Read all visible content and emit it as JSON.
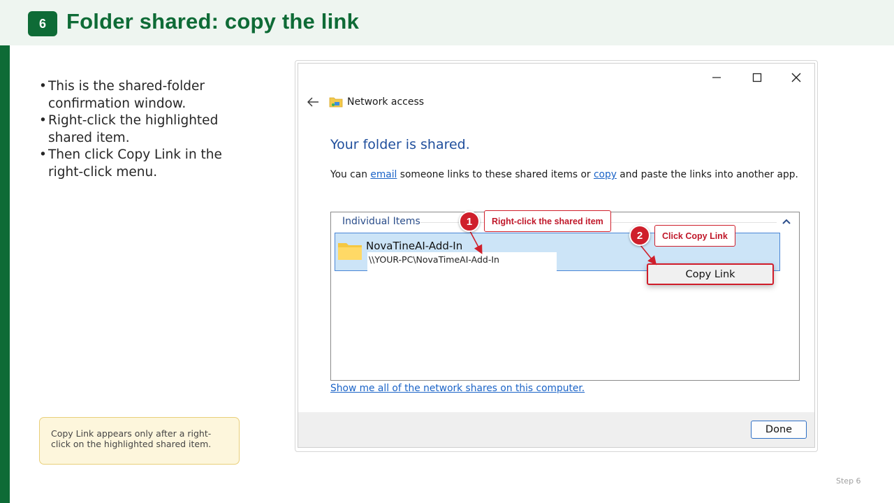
{
  "slide": {
    "step_number": "6",
    "title": "Folder shared: copy the link",
    "bullets": [
      "This is the shared-folder confirmation window.",
      "Right-click the highlighted shared item.",
      "Then click Copy Link in the right-click menu."
    ],
    "note": "Copy Link appears only after a right-click on the highlighted shared item.",
    "footer": "Step 6",
    "accent_color": "#0e6b36"
  },
  "dialog": {
    "window_controls": {
      "minimize": "—",
      "maximize": "☐",
      "close": "✕"
    },
    "nav_title": "Network access",
    "heading": "Your folder is shared.",
    "description": {
      "before": "You can ",
      "email_link": "email",
      "middle": " someone links to these shared items or ",
      "copy_link": "copy",
      "after": " and paste the links into another app."
    },
    "group_header": "Individual Items",
    "shared_item": {
      "name": "NovaTineAI-Add-In",
      "path": "\\\\YOUR-PC\\NovaTimeAI-Add-In"
    },
    "context_menu_item": "Copy Link",
    "network_shares_link": "Show me all of the network shares on this computer.",
    "done_button": "Done"
  },
  "callouts": [
    {
      "number": "1",
      "label": "Right-click the shared item"
    },
    {
      "number": "2",
      "label": "Click Copy Link"
    }
  ],
  "callout_color": "#cf1f2b"
}
